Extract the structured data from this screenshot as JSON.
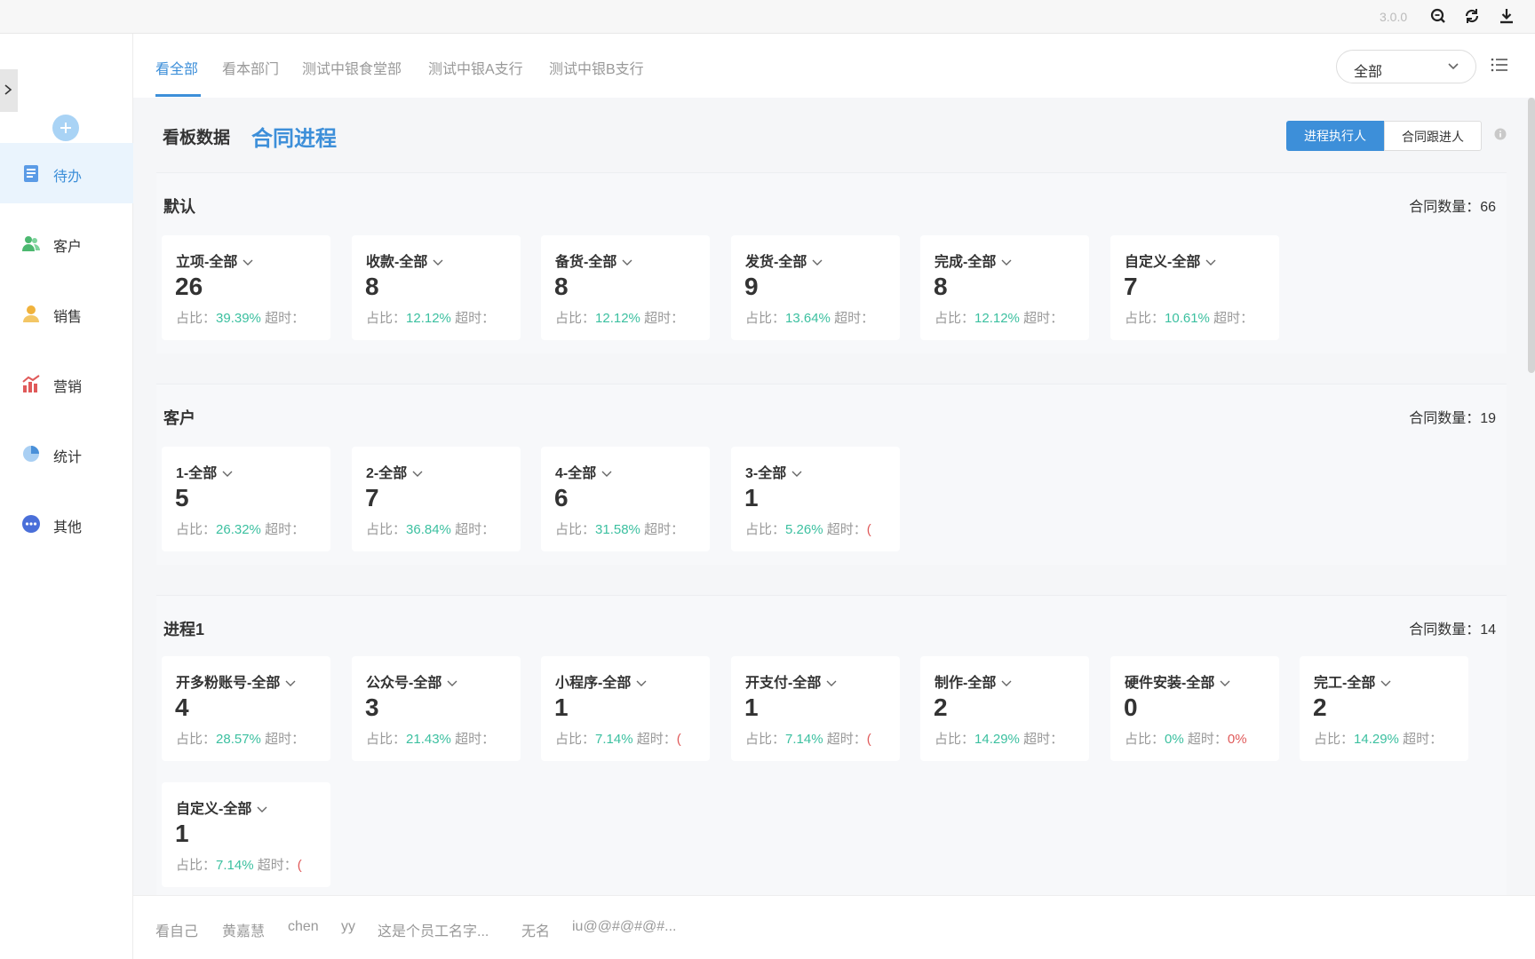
{
  "topbar": {
    "version": "3.0.0",
    "icons": [
      "zoom-icon",
      "refresh-icon",
      "download-icon"
    ]
  },
  "sidebar": {
    "items": [
      {
        "label": "待办",
        "icon": "todo-icon",
        "active": true
      },
      {
        "label": "客户",
        "icon": "customer-icon"
      },
      {
        "label": "销售",
        "icon": "sales-icon"
      },
      {
        "label": "营销",
        "icon": "marketing-icon"
      },
      {
        "label": "统计",
        "icon": "statistics-icon"
      },
      {
        "label": "其他",
        "icon": "more-icon"
      }
    ]
  },
  "tabs": {
    "items": [
      "看全部",
      "看本部门",
      "测试中银食堂部",
      "测试中银A支行",
      "测试中银B支行"
    ],
    "active_index": 0,
    "select_value": "全部"
  },
  "board": {
    "title": "看板数据",
    "subtitle": "合同进程",
    "toggle_on": "进程执行人",
    "toggle_off": "合同跟进人"
  },
  "groups": [
    {
      "title": "默认",
      "count_label": "合同数量：66",
      "cards": [
        {
          "title": "立项-全部",
          "value": "26",
          "ratio_label": "占比：",
          "ratio": "39.39%",
          "overtime_label": "超时：",
          "overtime": ""
        },
        {
          "title": "收款-全部",
          "value": "8",
          "ratio_label": "占比：",
          "ratio": "12.12%",
          "overtime_label": "超时：",
          "overtime": ""
        },
        {
          "title": "备货-全部",
          "value": "8",
          "ratio_label": "占比：",
          "ratio": "12.12%",
          "overtime_label": "超时：",
          "overtime": ""
        },
        {
          "title": "发货-全部",
          "value": "9",
          "ratio_label": "占比：",
          "ratio": "13.64%",
          "overtime_label": "超时：",
          "overtime": ""
        },
        {
          "title": "完成-全部",
          "value": "8",
          "ratio_label": "占比：",
          "ratio": "12.12%",
          "overtime_label": "超时：",
          "overtime": ""
        },
        {
          "title": "自定义-全部",
          "value": "7",
          "ratio_label": "占比：",
          "ratio": "10.61%",
          "overtime_label": "超时：",
          "overtime": ""
        }
      ]
    },
    {
      "title": "客户",
      "count_label": "合同数量：19",
      "cards": [
        {
          "title": "1-全部",
          "value": "5",
          "ratio_label": "占比：",
          "ratio": "26.32%",
          "overtime_label": "超时：",
          "overtime": ""
        },
        {
          "title": "2-全部",
          "value": "7",
          "ratio_label": "占比：",
          "ratio": "36.84%",
          "overtime_label": "超时：",
          "overtime": ""
        },
        {
          "title": "4-全部",
          "value": "6",
          "ratio_label": "占比：",
          "ratio": "31.58%",
          "overtime_label": "超时：",
          "overtime": ""
        },
        {
          "title": "3-全部",
          "value": "1",
          "ratio_label": "占比：",
          "ratio": "5.26%",
          "overtime_label": "超时：",
          "overtime": "("
        }
      ]
    },
    {
      "title": "进程1",
      "count_label": "合同数量：14",
      "cards": [
        {
          "title": "开多粉账号-全部",
          "value": "4",
          "ratio_label": "占比：",
          "ratio": "28.57%",
          "overtime_label": "超时：",
          "overtime": ""
        },
        {
          "title": "公众号-全部",
          "value": "3",
          "ratio_label": "占比：",
          "ratio": "21.43%",
          "overtime_label": "超时：",
          "overtime": ""
        },
        {
          "title": "小程序-全部",
          "value": "1",
          "ratio_label": "占比：",
          "ratio": "7.14%",
          "overtime_label": "超时：",
          "overtime": "("
        },
        {
          "title": "开支付-全部",
          "value": "1",
          "ratio_label": "占比：",
          "ratio": "7.14%",
          "overtime_label": "超时：",
          "overtime": "("
        },
        {
          "title": "制作-全部",
          "value": "2",
          "ratio_label": "占比：",
          "ratio": "14.29%",
          "overtime_label": "超时：",
          "overtime": ""
        },
        {
          "title": "硬件安装-全部",
          "value": "0",
          "ratio_label": "占比：",
          "ratio": "0%",
          "overtime_label": "超时：",
          "overtime": "0%"
        },
        {
          "title": "完工-全部",
          "value": "2",
          "ratio_label": "占比：",
          "ratio": "14.29%",
          "overtime_label": "超时：",
          "overtime": ""
        },
        {
          "title": "自定义-全部",
          "value": "1",
          "ratio_label": "占比：",
          "ratio": "7.14%",
          "overtime_label": "超时：",
          "overtime": "("
        }
      ]
    }
  ],
  "bottom_tabs": [
    "看自己",
    "黄嘉慧",
    "chen",
    "yy",
    "这是个员工名字...",
    "无名",
    "iu@@#@#@#..."
  ],
  "colors": {
    "accent": "#3d8fd9",
    "ratio": "#3cc0a0",
    "overtime": "#e05a5a"
  }
}
